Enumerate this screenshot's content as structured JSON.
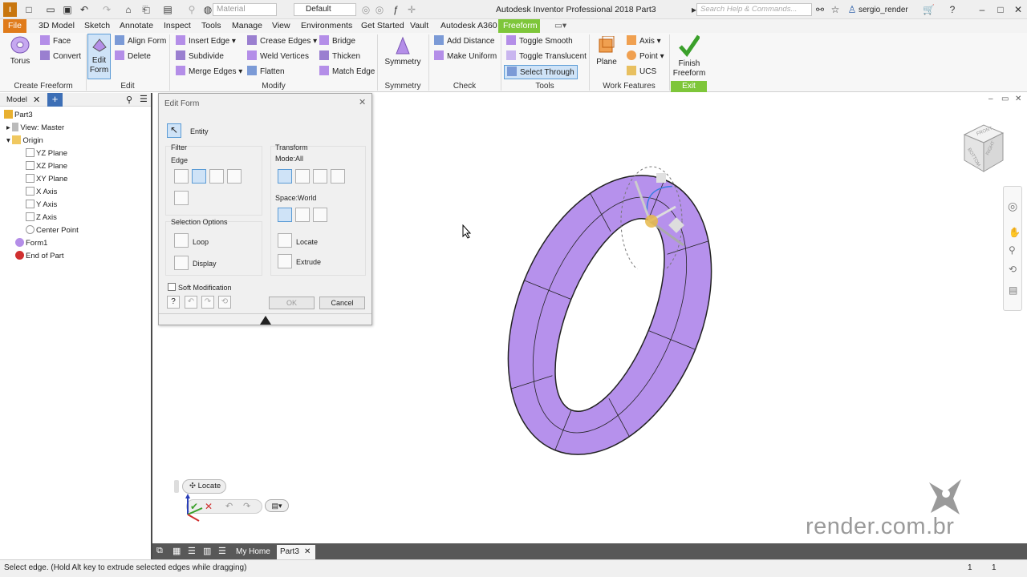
{
  "titlebar": {
    "logo": "I PRO",
    "material_placeholder": "Material",
    "appearance_value": "Default",
    "title": "Autodesk Inventor Professional 2018    Part3",
    "search_placeholder": "Search Help & Commands...",
    "user": "sergio_render"
  },
  "tabs": [
    "File",
    "3D Model",
    "Sketch",
    "Annotate",
    "Inspect",
    "Tools",
    "Manage",
    "View",
    "Environments",
    "Get Started",
    "Vault",
    "Autodesk A360",
    "Freeform"
  ],
  "ribbon": {
    "torus": "Torus",
    "face": "Face",
    "convert": "Convert",
    "create_freeform": "Create Freeform",
    "edit_form_1": "Edit",
    "edit_form_2": "Form",
    "align_form": "Align Form",
    "delete": "Delete",
    "edit": "Edit",
    "insert_edge": "Insert Edge",
    "subdivide": "Subdivide",
    "merge_edges": "Merge Edges",
    "crease_edges": "Crease Edges",
    "weld_vertices": "Weld Vertices",
    "flatten": "Flatten",
    "bridge": "Bridge",
    "thicken": "Thicken",
    "match_edge": "Match Edge",
    "modify": "Modify",
    "symmetry_btn": "Symmetry",
    "symmetry": "Symmetry",
    "add_distance": "Add Distance",
    "make_uniform": "Make Uniform",
    "check": "Check",
    "toggle_smooth": "Toggle Smooth",
    "toggle_translucent": "Toggle Translucent",
    "select_through": "Select Through",
    "tools": "Tools",
    "plane": "Plane",
    "axis": "Axis",
    "point": "Point",
    "ucs": "UCS",
    "work_features": "Work Features",
    "finish_1": "Finish",
    "finish_2": "Freeform",
    "exit": "Exit"
  },
  "browser": {
    "tab": "Model",
    "items": [
      "Part3",
      "View: Master",
      "Origin",
      "YZ Plane",
      "XZ Plane",
      "XY Plane",
      "X Axis",
      "Y Axis",
      "Z Axis",
      "Center Point",
      "Form1",
      "End of Part"
    ]
  },
  "dialog": {
    "title": "Edit Form",
    "entity": "Entity",
    "filter": "Filter",
    "edge": "Edge",
    "transform": "Transform",
    "mode": "Mode:All",
    "space": "Space:World",
    "selection_options": "Selection Options",
    "loop": "Loop",
    "display": "Display",
    "locate": "Locate",
    "extrude": "Extrude",
    "soft_modification": "Soft Modification",
    "ok": "OK",
    "cancel": "Cancel"
  },
  "minitoolbar": {
    "locate": "Locate"
  },
  "viewcube": {
    "front": "FRONT",
    "bottom": "BOTTOM",
    "right": "RIGHT"
  },
  "watermark": {
    "text": "render.com.br"
  },
  "doctabs": {
    "home": "My Home",
    "part": "Part3"
  },
  "statusbar": {
    "text": "Select edge. (Hold Alt key to extrude selected edges while dragging)",
    "count1": "1",
    "count2": "1"
  },
  "colors": {
    "torus": "#b691ec",
    "file_tab": "#e07b1a",
    "freeform_tab": "#7ec63a",
    "selection": "#cfe3f7"
  }
}
